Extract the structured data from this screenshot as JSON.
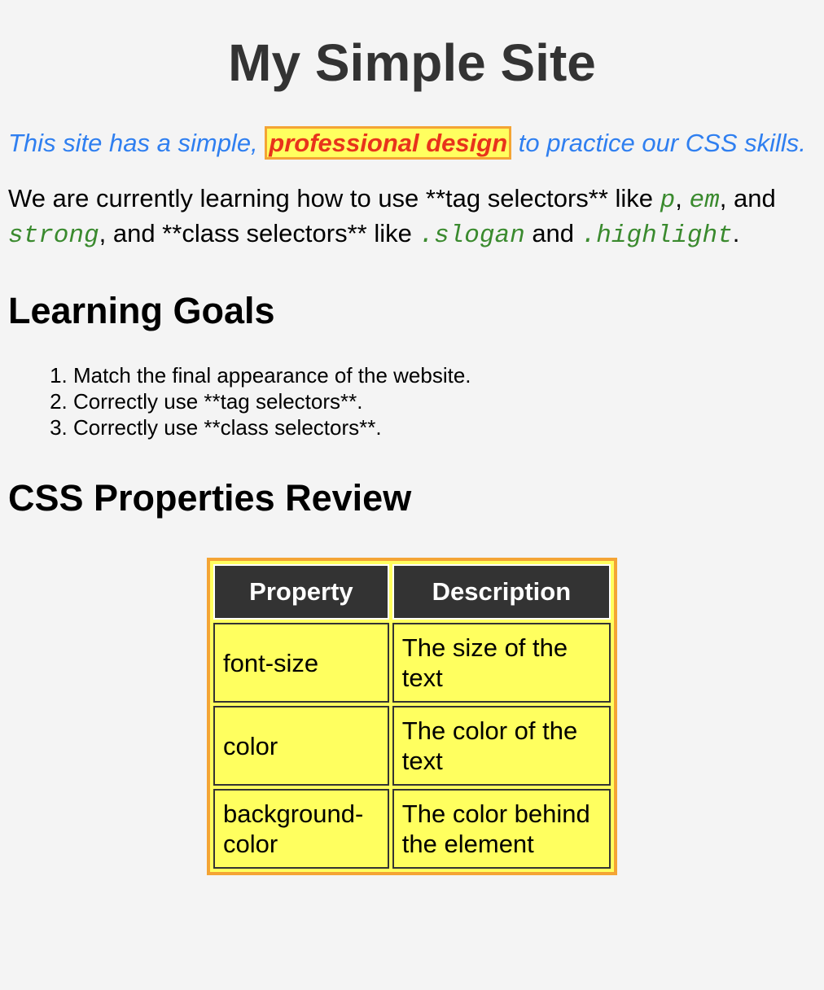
{
  "header": {
    "title": "My Simple Site"
  },
  "slogan": {
    "before": "This site has a simple, ",
    "highlight": "professional design",
    "after": " to practice our CSS skills."
  },
  "intro": {
    "part1": "We are currently learning how to use **tag selectors** like ",
    "code_p": "p",
    "sep1": ", ",
    "code_em": "em",
    "sep2": ", and ",
    "code_strong": "strong",
    "part2": ", and **class selectors** like ",
    "code_slogan": ".slogan",
    "sep3": " and ",
    "code_highlight": ".highlight",
    "end": "."
  },
  "goals": {
    "heading": "Learning Goals",
    "items": [
      "Match the final appearance of the website.",
      "Correctly use **tag selectors**.",
      "Correctly use **class selectors**."
    ]
  },
  "review": {
    "heading": "CSS Properties Review",
    "columns": [
      "Property",
      "Description"
    ],
    "rows": [
      [
        "font-size",
        "The size of the text"
      ],
      [
        "color",
        "The color of the text"
      ],
      [
        "background-color",
        "The color behind the element"
      ]
    ]
  },
  "colors": {
    "background": "#f4f4f4",
    "title": "#333333",
    "slogan": "#2f7ff0",
    "highlight_text": "#e8331b",
    "highlight_bg": "#ffff5f",
    "highlight_border": "#f4a434",
    "code": "#3a8a2e",
    "table_header_bg": "#333333"
  }
}
